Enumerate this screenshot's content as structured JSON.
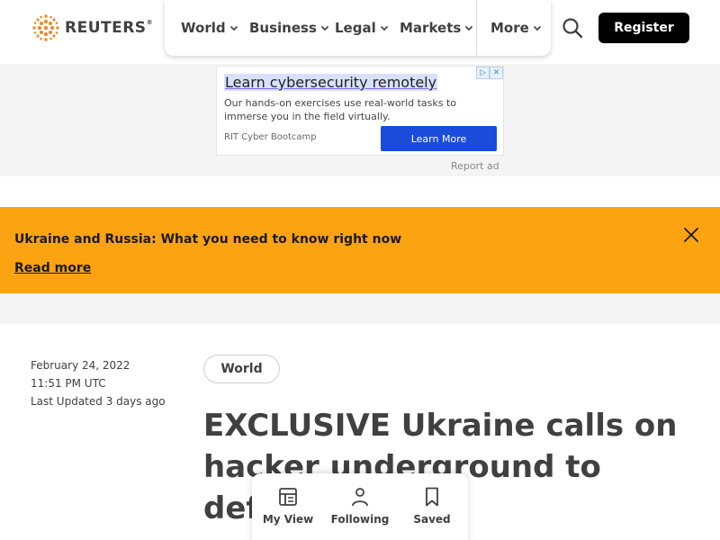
{
  "header": {
    "logo_text": "REUTERS",
    "logo_mark": "®",
    "nav": [
      {
        "label": "World"
      },
      {
        "label": "Business"
      },
      {
        "label": "Legal"
      },
      {
        "label": "Markets"
      },
      {
        "label": "More"
      }
    ],
    "search_icon": "search-icon",
    "register_label": "Register"
  },
  "ad": {
    "title": "Learn cybersecurity remotely",
    "body": "Our hands-on exercises use real-world tasks to immerse you in the field virtually.",
    "sponsor": "RIT Cyber Bootcamp",
    "cta": "Learn More",
    "report_label": "Report ad"
  },
  "banner": {
    "title": "Ukraine and Russia: What you need to know right now",
    "link": "Read more",
    "background": "#fca311"
  },
  "article": {
    "date": "February 24, 2022",
    "time": "11:51 PM UTC",
    "updated": "Last Updated 3 days ago",
    "section": "World",
    "headline": "EXCLUSIVE Ukraine calls on hacker underground to defend aga"
  },
  "dock": {
    "items": [
      {
        "label": "My View",
        "icon": "layout-icon"
      },
      {
        "label": "Following",
        "icon": "person-icon"
      },
      {
        "label": "Saved",
        "icon": "bookmark-icon"
      }
    ]
  },
  "colors": {
    "register_bg": "#000000",
    "ad_cta_bg": "#1a4bdb",
    "text": "#404040",
    "logo_accent": "#f08a24"
  }
}
